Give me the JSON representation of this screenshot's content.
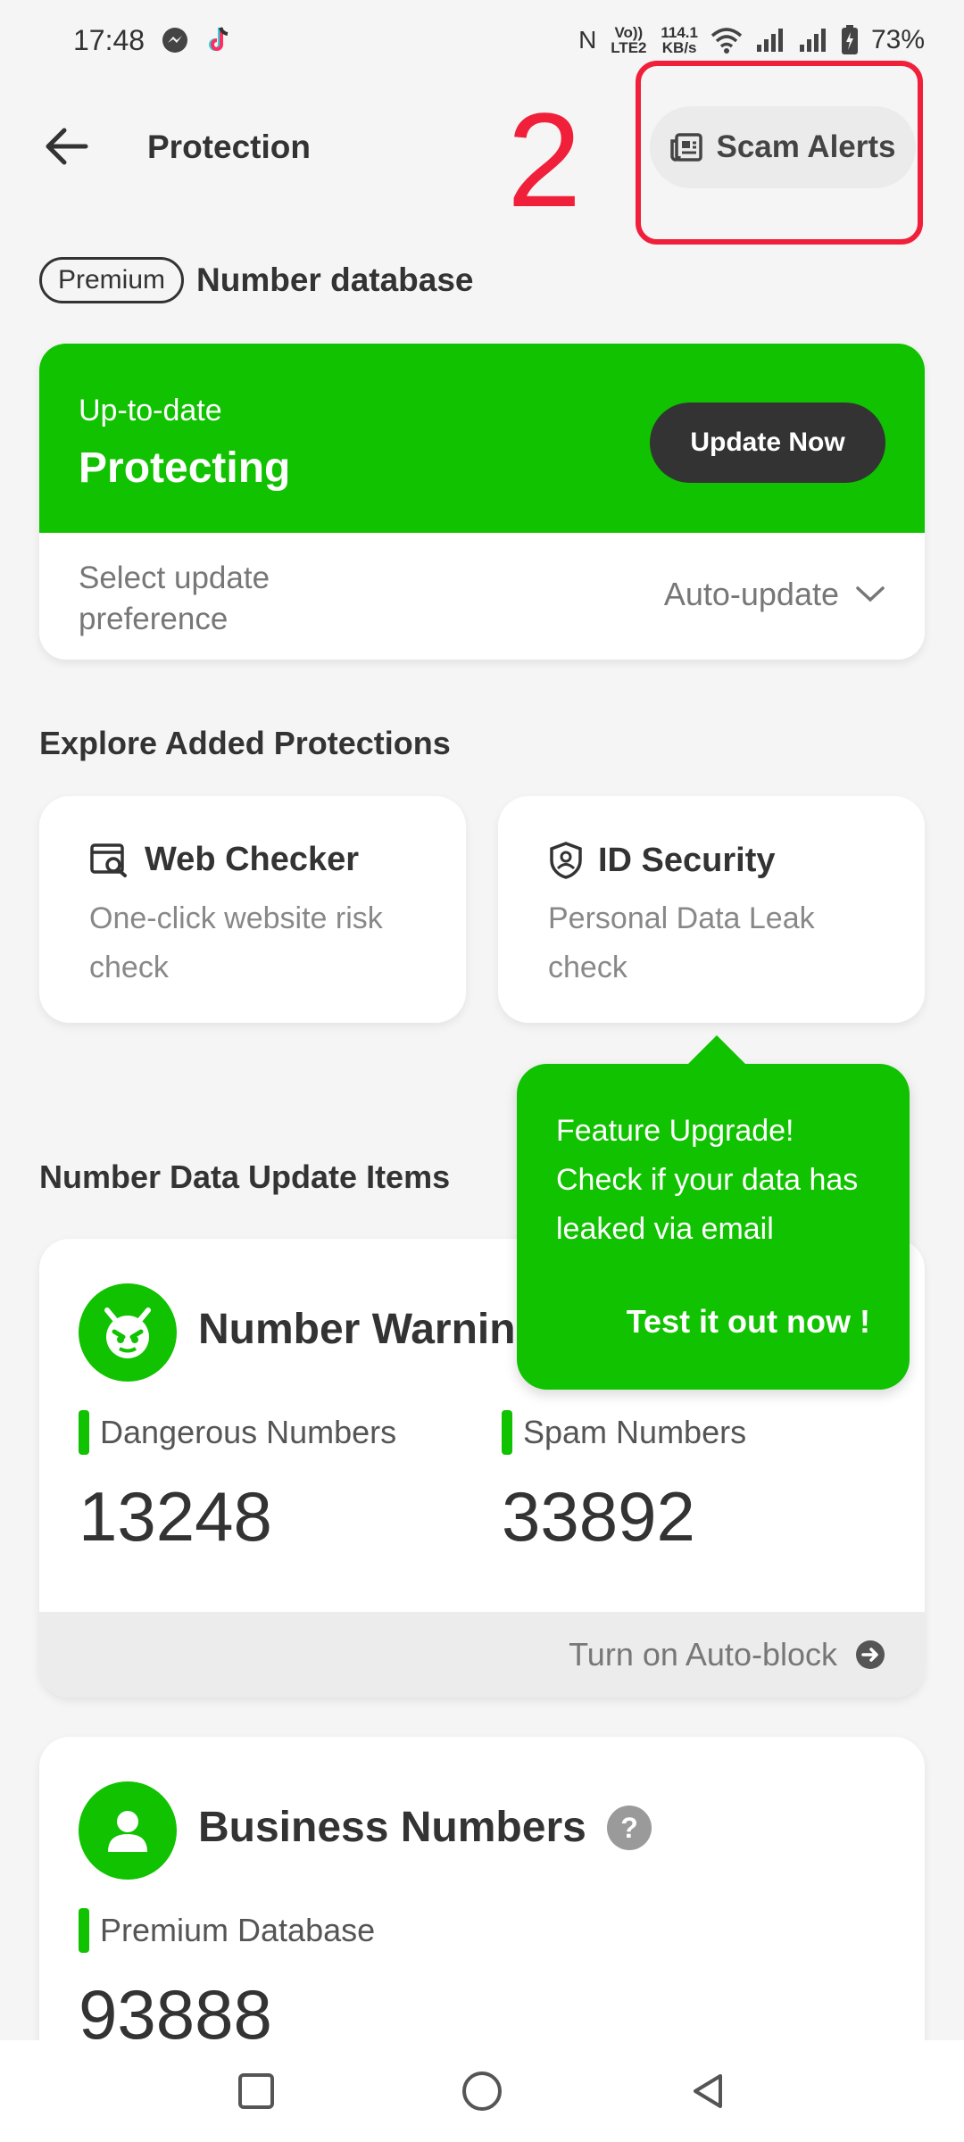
{
  "status_bar": {
    "time": "17:48",
    "network_speed_top": "114.1",
    "network_speed_unit": "KB/s",
    "volte": "Vo)) LTE2",
    "battery": "73%",
    "nfc": "N"
  },
  "header": {
    "title": "Protection",
    "scam_alerts_label": "Scam Alerts",
    "annotation_number": "2"
  },
  "database": {
    "premium_badge": "Premium",
    "title": "Number database",
    "status_sub": "Up-to-date",
    "status_main": "Protecting",
    "update_button": "Update Now",
    "pref_label": "Select update preference",
    "pref_value": "Auto-update"
  },
  "explore": {
    "title": "Explore Added Protections",
    "cards": [
      {
        "title": "Web Checker",
        "desc": "One-click website risk check"
      },
      {
        "title": "ID Security",
        "desc": "Personal Data Leak check"
      }
    ]
  },
  "tooltip": {
    "text": "Feature Upgrade! Check if your data has leaked via email",
    "cta": "Test it out now !"
  },
  "updates": {
    "title": "Number Data Update Items",
    "warning_card": {
      "title": "Number Warning",
      "dangerous_label": "Dangerous Numbers",
      "dangerous_value": "13248",
      "spam_label": "Spam Numbers",
      "spam_value": "33892",
      "footer": "Turn on Auto-block"
    },
    "business_card": {
      "title": "Business Numbers",
      "premium_label": "Premium Database",
      "premium_value": "93888"
    }
  },
  "colors": {
    "accent_green": "#10c200",
    "annotation_red": "#f0203a",
    "dark_button": "#333333"
  }
}
